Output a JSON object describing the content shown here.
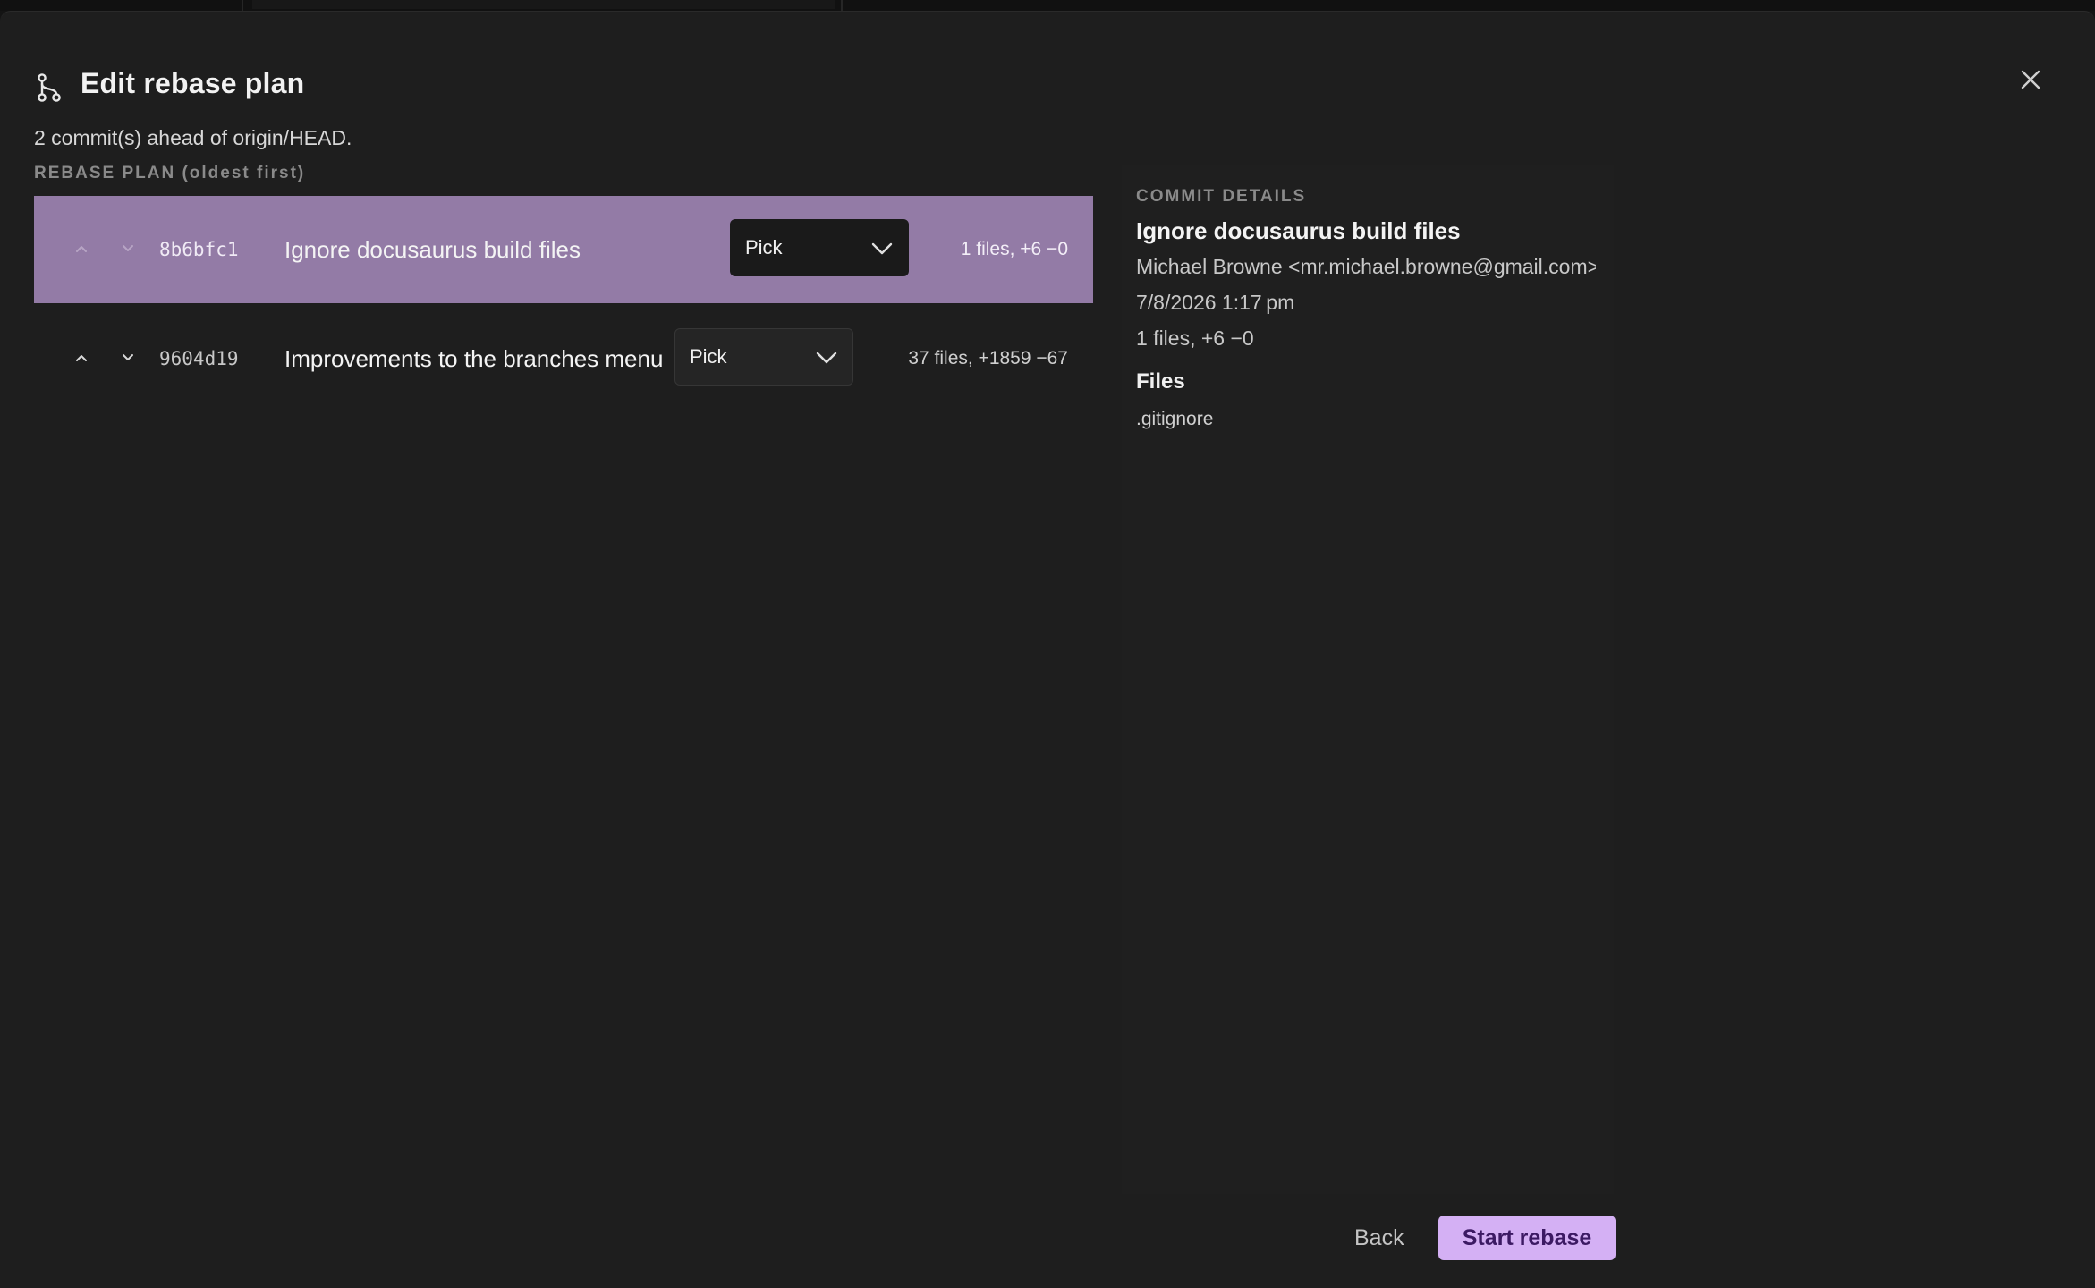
{
  "dialog": {
    "title": "Edit rebase plan",
    "subtitle": "2 commit(s) ahead of origin/HEAD.",
    "section_label": "REBASE PLAN (oldest first)"
  },
  "commits": [
    {
      "sha": "8b6bfc1",
      "message": "Ignore docusaurus build files",
      "action": "Pick",
      "stats": "1 files, +6 −0",
      "selected": true
    },
    {
      "sha": "9604d19",
      "message": "Improvements to the branches menu",
      "action": "Pick",
      "stats": "37 files, +1859 −67",
      "selected": false
    }
  ],
  "details": {
    "label": "COMMIT DETAILS",
    "title": "Ignore docusaurus build files",
    "author": "Michael Browne <mr.michael.browne@gmail.com>",
    "date": "7/8/2026 1:17 pm",
    "stats": "1 files, +6 −0",
    "files_heading": "Files",
    "files": [
      ".gitignore"
    ]
  },
  "footer": {
    "back_label": "Back",
    "start_label": "Start rebase"
  },
  "colors": {
    "selected_row": "#937ba6",
    "primary_button": "#d4b0f4",
    "primary_button_text": "#3c1a63",
    "background": "#1e1e1e"
  },
  "icons": {
    "header": "git-branch-icon",
    "close": "close-icon",
    "move_up": "chevron-up-icon",
    "move_down": "chevron-down-icon",
    "dropdown": "chevron-down-icon"
  }
}
